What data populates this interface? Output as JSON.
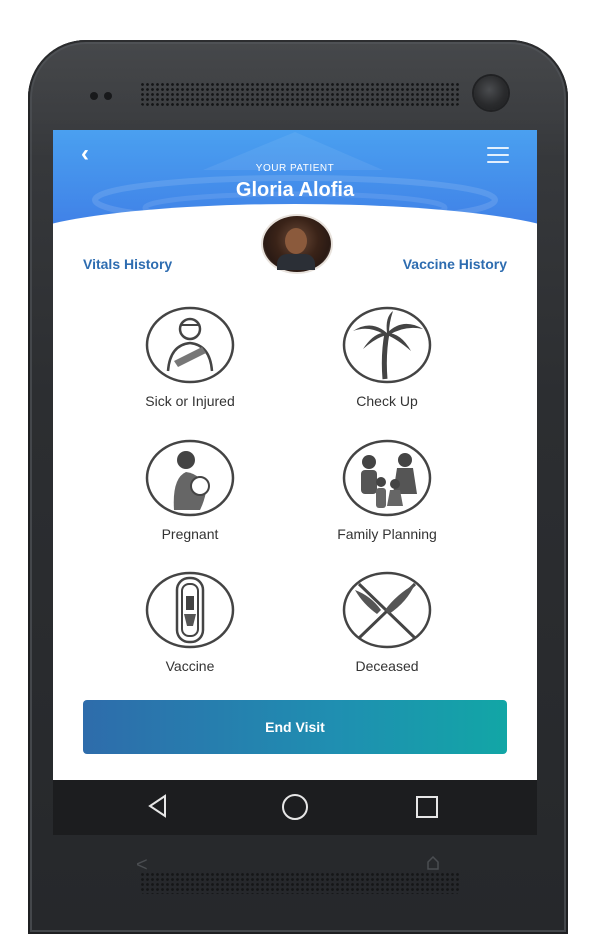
{
  "header": {
    "overline": "YOUR PATIENT",
    "patient_name": "Gloria Alofia"
  },
  "links": {
    "vitals_history": "Vitals History",
    "vaccine_history": "Vaccine History"
  },
  "visit_types": [
    {
      "label": "Sick or Injured",
      "icon": "sick-injured-icon"
    },
    {
      "label": "Check Up",
      "icon": "palm-tree-icon"
    },
    {
      "label": "Pregnant",
      "icon": "pregnant-icon"
    },
    {
      "label": "Family Planning",
      "icon": "family-icon"
    },
    {
      "label": "Vaccine",
      "icon": "vaccine-vial-icon"
    },
    {
      "label": "Deceased",
      "icon": "crossed-palms-icon"
    }
  ],
  "end_visit": {
    "label": "End Visit"
  },
  "colors": {
    "header_top": "#4aa0f0",
    "header_bottom": "#3f7ee6",
    "link": "#2d6cb0",
    "button_start": "#2e6cab",
    "button_end": "#12a6a6"
  }
}
